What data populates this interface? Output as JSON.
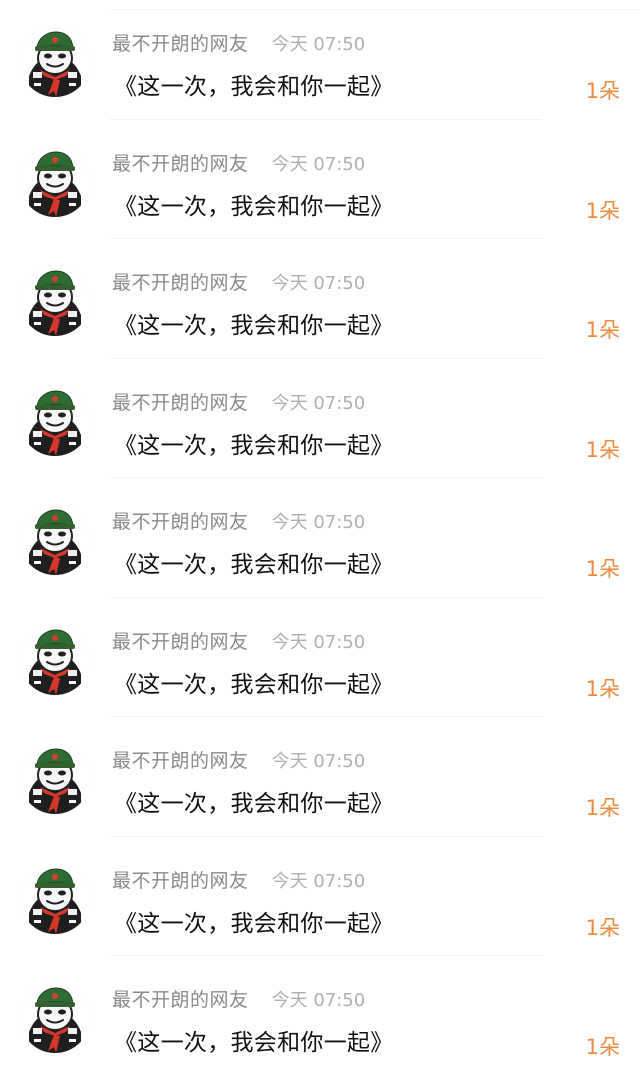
{
  "gift_list": {
    "items": [
      {
        "user": "最不开朗的网友",
        "time": "今天 07:50",
        "message": "《这一次，我会和你一起》",
        "gift": "1朵"
      },
      {
        "user": "最不开朗的网友",
        "time": "今天 07:50",
        "message": "《这一次，我会和你一起》",
        "gift": "1朵"
      },
      {
        "user": "最不开朗的网友",
        "time": "今天 07:50",
        "message": "《这一次，我会和你一起》",
        "gift": "1朵"
      },
      {
        "user": "最不开朗的网友",
        "time": "今天 07:50",
        "message": "《这一次，我会和你一起》",
        "gift": "1朵"
      },
      {
        "user": "最不开朗的网友",
        "time": "今天 07:50",
        "message": "《这一次，我会和你一起》",
        "gift": "1朵"
      },
      {
        "user": "最不开朗的网友",
        "time": "今天 07:50",
        "message": "《这一次，我会和你一起》",
        "gift": "1朵"
      },
      {
        "user": "最不开朗的网友",
        "time": "今天 07:50",
        "message": "《这一次，我会和你一起》",
        "gift": "1朵"
      },
      {
        "user": "最不开朗的网友",
        "time": "今天 07:50",
        "message": "《这一次，我会和你一起》",
        "gift": "1朵"
      },
      {
        "user": "最不开朗的网友",
        "time": "今天 07:50",
        "message": "《这一次，我会和你一起》",
        "gift": "1朵"
      }
    ]
  },
  "avatar": {
    "icon": "panda-meme-avatar-icon",
    "colors": {
      "hat": "#2f6b34",
      "star": "#d63b2f",
      "scarf": "#d9362b",
      "outline": "#222222"
    }
  },
  "colors": {
    "name": "#8a8a8a",
    "time": "#b0b0b0",
    "message": "#111111",
    "gift": "#f08a3e"
  }
}
